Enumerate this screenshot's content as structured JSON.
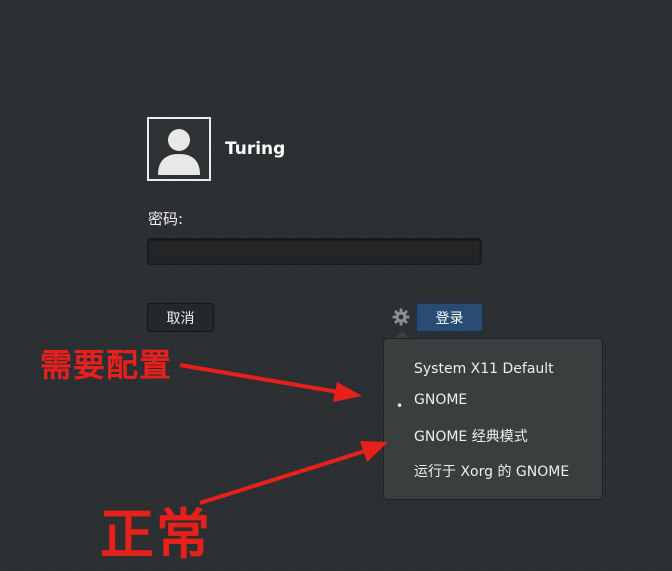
{
  "user": {
    "name": "Turing"
  },
  "password": {
    "label": "密码:",
    "value": ""
  },
  "buttons": {
    "cancel": "取消",
    "login": "登录"
  },
  "session_menu": {
    "items": [
      {
        "label": "System X11 Default",
        "selected": false
      },
      {
        "label": "GNOME",
        "selected": true
      },
      {
        "label": "GNOME 经典模式",
        "selected": false
      },
      {
        "label": "运行于 Xorg 的 GNOME",
        "selected": false
      }
    ],
    "bullet": "•"
  },
  "annotations": {
    "needs_config": "需要配置",
    "normal": "正常",
    "color": "#e8201c"
  },
  "colors": {
    "background": "#2b2e31",
    "login_button": "#2a4b73",
    "menu_background": "#393f3f"
  }
}
